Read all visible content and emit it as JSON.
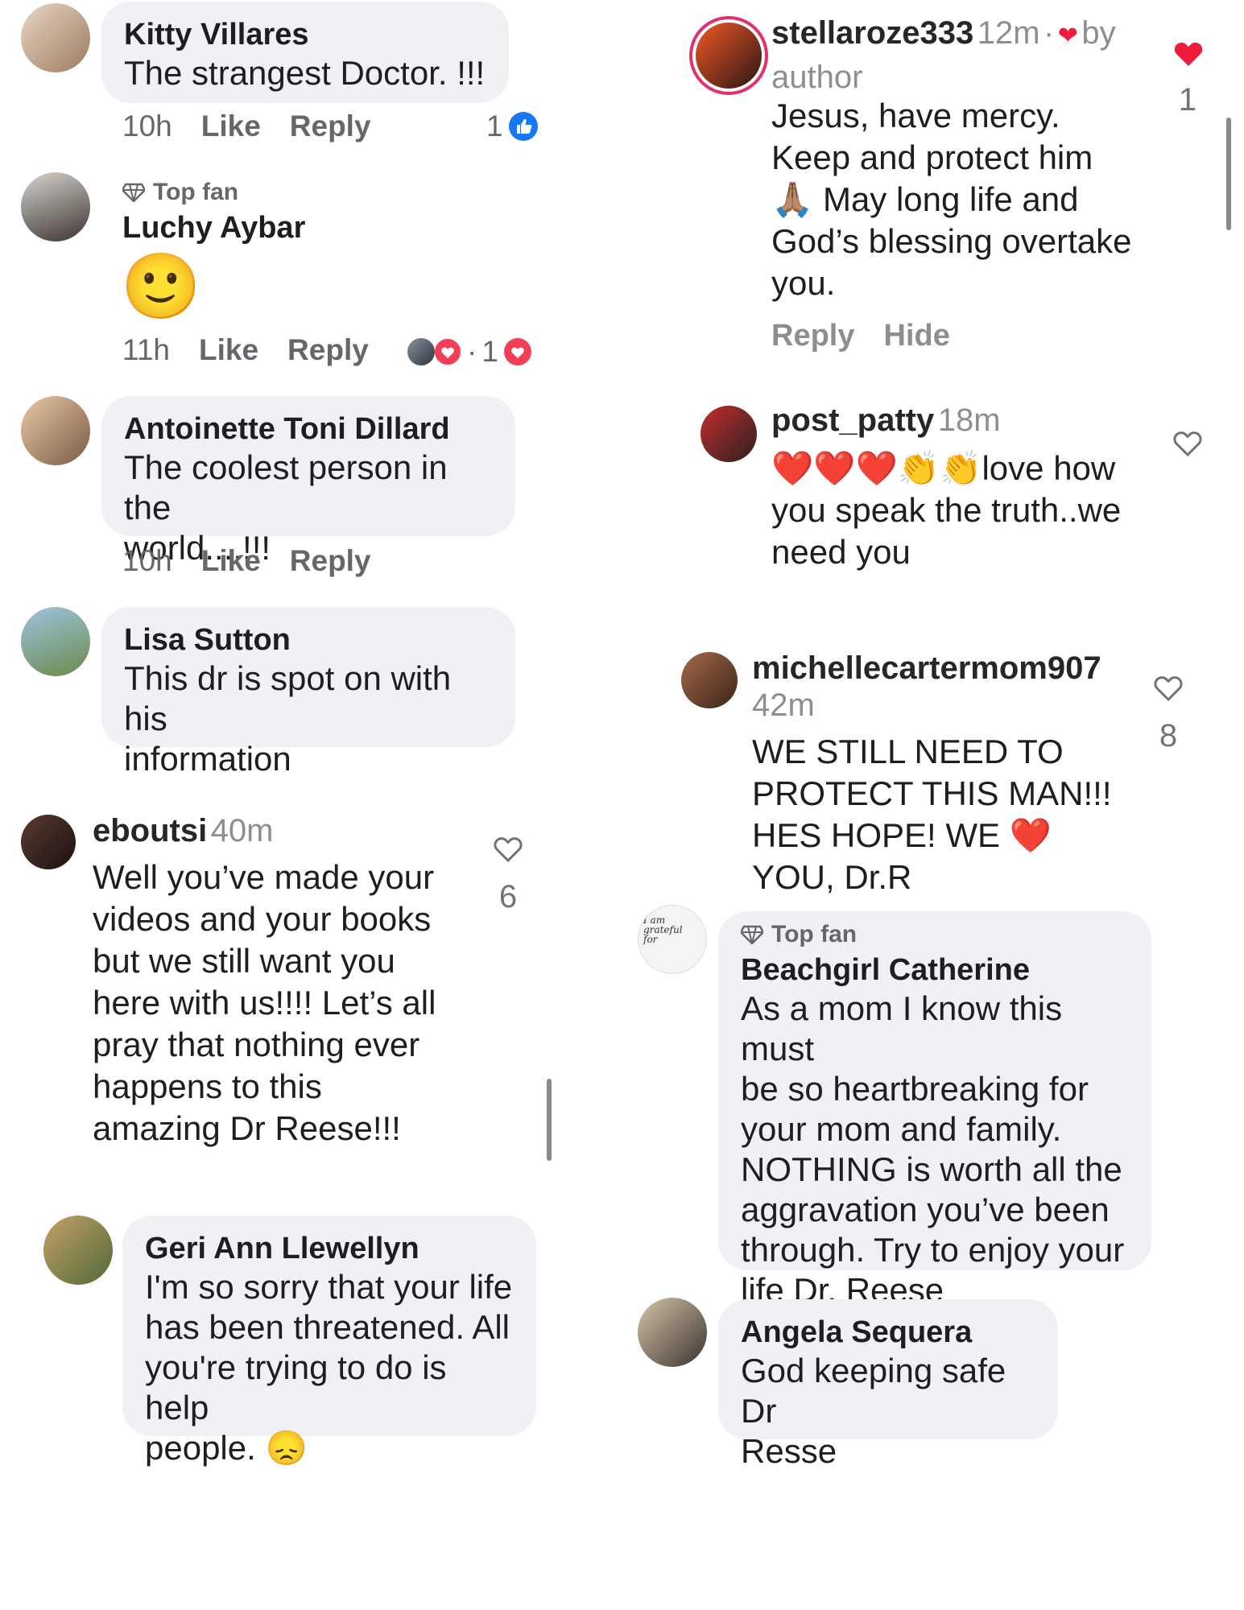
{
  "left_column": {
    "kitty": {
      "name": "Kitty Villares",
      "text": "The strangest Doctor.  !!!",
      "time": "10h",
      "like": "Like",
      "reply": "Reply",
      "reaction_count": "1"
    },
    "luchy": {
      "badge": "Top fan",
      "name": "Luchy Aybar",
      "emoji": "🙂",
      "time": "11h",
      "like": "Like",
      "reply": "Reply",
      "reaction_count": "1"
    },
    "antoinette": {
      "name": "Antoinette Toni Dillard",
      "text": "The coolest person in the\nworld....!!!",
      "time": "10h",
      "like": "Like",
      "reply": "Reply"
    },
    "lisa": {
      "name": "Lisa Sutton",
      "text": "This dr is spot on with his\ninformation"
    },
    "eboutsi": {
      "username": "eboutsi",
      "time": "40m",
      "text": "Well you’ve made your\nvideos and your books\nbut we still want you\nhere with us!!!! Let’s all\npray that nothing ever\nhappens to this\namazing Dr Reese!!!",
      "likes": "6"
    },
    "geri": {
      "name": "Geri Ann Llewellyn",
      "text": "I'm so sorry that your life\nhas been threatened. All\nyou're trying to do is help\npeople. 😞"
    }
  },
  "right_column": {
    "stella": {
      "username": "stellaroze333",
      "time": "12m",
      "separator": "·",
      "liked_by": "by",
      "liked_by_2": "author",
      "text": "Jesus, have mercy.\nKeep and protect him\n🙏🏽 May long life and\nGod’s blessing overtake\nyou.",
      "reply": "Reply",
      "hide": "Hide",
      "likes": "1"
    },
    "patty": {
      "username": "post_patty",
      "time": "18m",
      "text": "❤️❤️❤️👏👏love how\nyou speak  the truth..we\nneed you"
    },
    "michelle": {
      "username": "michellecartermom907",
      "time": "42m",
      "text": "WE STILL NEED TO\nPROTECT THIS MAN!!!\nHES HOPE! WE ❤️\nYOU, Dr.R",
      "likes": "8"
    },
    "beachgirl": {
      "badge": "Top fan",
      "name": "Beachgirl Catherine",
      "text": "As a mom I know this must\nbe so heartbreaking for\nyour mom and family.\nNOTHING is worth all the\naggravation you’ve been\nthrough. Try to enjoy your\nlife Dr. Reese",
      "avatar_text": "I am\ngrateful\nfor"
    },
    "angela": {
      "name": "Angela Sequera",
      "text": "God keeping safe Dr\nResse"
    }
  },
  "colors": {
    "bubble": "#eff1f4",
    "fb_blue": "#1877f2",
    "heart_red": "#ed1c3a",
    "love_red": "#f33e58",
    "muted": "#65676b"
  }
}
